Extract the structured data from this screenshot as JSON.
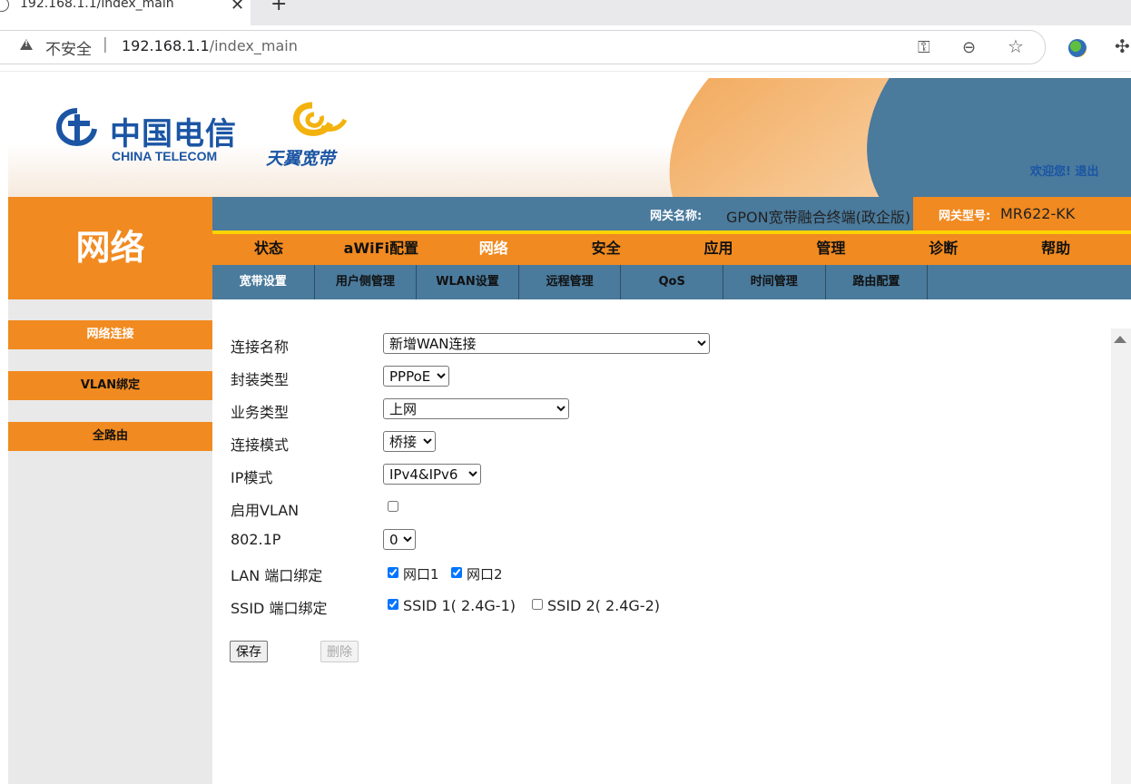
{
  "browser": {
    "tab_title": "192.168.1.1/index_main",
    "tab_close": "✕",
    "new_tab": "+",
    "security_label": "不安全",
    "separator": "|",
    "url_host": "192.168.1.1",
    "url_path": "/index_main",
    "icons": [
      "key-icon",
      "zoom-out-icon",
      "star-icon",
      "extension-icon",
      "puzzle-icon"
    ]
  },
  "header": {
    "logo_cn": "中国电信",
    "logo_en": "CHINA TELECOM",
    "tianyi": "天翼宽带",
    "welcome": "欢迎您!",
    "logout": "退出",
    "colors": {
      "orange": "#f18a20",
      "blue": "#4a7a9c",
      "yellow": "#ffd400",
      "brand_blue": "#1b55a4"
    }
  },
  "gateway": {
    "name_label": "网关名称:",
    "name_value": "GPON宽带融合终端(政企版)",
    "model_label": "网关型号:",
    "model_value": "MR622-KK"
  },
  "section_title": "网络",
  "main_nav": [
    "状态",
    "aWiFi配置",
    "网络",
    "安全",
    "应用",
    "管理",
    "诊断",
    "帮助"
  ],
  "main_nav_active": 2,
  "sub_nav": [
    "宽带设置",
    "用户侧管理",
    "WLAN设置",
    "远程管理",
    "QoS",
    "时间管理",
    "路由配置"
  ],
  "sub_nav_active": 0,
  "sidebar": [
    "网络连接",
    "VLAN绑定",
    "全路由"
  ],
  "sidebar_active": 0,
  "form": {
    "connection_name": {
      "label": "连接名称",
      "value": "新增WAN连接"
    },
    "encap_type": {
      "label": "封装类型",
      "value": "PPPoE"
    },
    "service_type": {
      "label": "业务类型",
      "value": "上网"
    },
    "conn_mode": {
      "label": "连接模式",
      "value": "桥接"
    },
    "ip_mode": {
      "label": "IP模式",
      "value": "IPv4&IPv6"
    },
    "vlan_enable": {
      "label": "启用VLAN",
      "checked": false
    },
    "dot1p": {
      "label": "802.1P",
      "value": "0"
    },
    "lan_bind": {
      "label": "LAN 端口绑定",
      "port1": "网口1",
      "port1_checked": true,
      "port2": "网口2",
      "port2_checked": true
    },
    "ssid_bind": {
      "label": "SSID 端口绑定",
      "ssid1": "SSID 1( 2.4G-1)",
      "ssid1_checked": true,
      "ssid2": "SSID 2( 2.4G-2)",
      "ssid2_checked": false
    },
    "save_label": "保存",
    "delete_label": "删除"
  }
}
